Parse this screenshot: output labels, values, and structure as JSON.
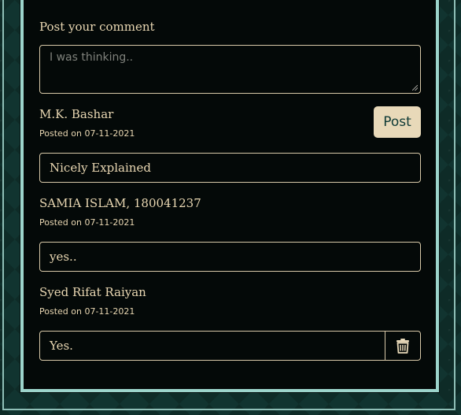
{
  "form": {
    "label": "Post your comment",
    "placeholder": "I was thinking..",
    "post_button_label": "Post"
  },
  "comments": [
    {
      "author": "M.K. Bashar",
      "date": "Posted on 07-11-2021",
      "text": "Nicely Explained"
    },
    {
      "author": "SAMIA ISLAM, 180041237",
      "date": "Posted on 07-11-2021",
      "text": "yes.."
    },
    {
      "author": "Syed Rifat Raiyan",
      "date": "Posted on 07-11-2021",
      "text": "Yes.",
      "delete_icon": "trash-icon"
    }
  ],
  "colors": {
    "panel_background": "#040908",
    "accent_text": "#e9d7b2",
    "border": "#d8c9a8",
    "button_background": "#e8d9b9",
    "button_text": "#0e3a36",
    "outer_border": "#9cd4cb"
  }
}
